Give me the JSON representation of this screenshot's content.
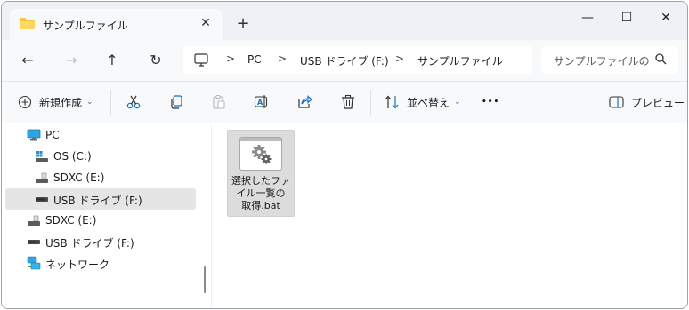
{
  "tab": {
    "title": "サンプルファイル",
    "close_glyph": "✕"
  },
  "new_tab_glyph": "+",
  "window_controls": {
    "minimize": "—",
    "maximize": "☐",
    "close": "✕"
  },
  "nav": {
    "back": "←",
    "forward": "→",
    "up": "↑",
    "refresh": "↻"
  },
  "address": {
    "crumbs": [
      "PC",
      "USB ドライブ (F:)",
      "サンプルファイル"
    ],
    "separator": ">"
  },
  "search": {
    "placeholder": "サンプルファイルの"
  },
  "toolbar": {
    "new_label": "新規作成",
    "sort_label": "並べ替え",
    "more_label": "•••",
    "preview_label": "プレビュー"
  },
  "sidebar": {
    "items": [
      {
        "label": "PC",
        "icon": "monitor-icon"
      },
      {
        "label": "OS (C:)",
        "icon": "os-drive-icon"
      },
      {
        "label": "SDXC (E:)",
        "icon": "sd-card-icon"
      },
      {
        "label": "USB ドライブ (F:)",
        "icon": "usb-drive-icon",
        "selected": true
      },
      {
        "label": "SDXC (E:)",
        "icon": "sd-card-icon"
      },
      {
        "label": "USB ドライブ (F:)",
        "icon": "usb-drive-icon"
      },
      {
        "label": "ネットワーク",
        "icon": "network-icon"
      }
    ]
  },
  "files": [
    {
      "name_lines": [
        "選択したファ",
        "イル一覧の",
        "取得.bat"
      ],
      "icon": "batch-file-gear-icon",
      "selected": true
    }
  ],
  "colors": {
    "accent": "#0067c0",
    "folder": "#f5c542",
    "selection": "#e5e5e5"
  }
}
